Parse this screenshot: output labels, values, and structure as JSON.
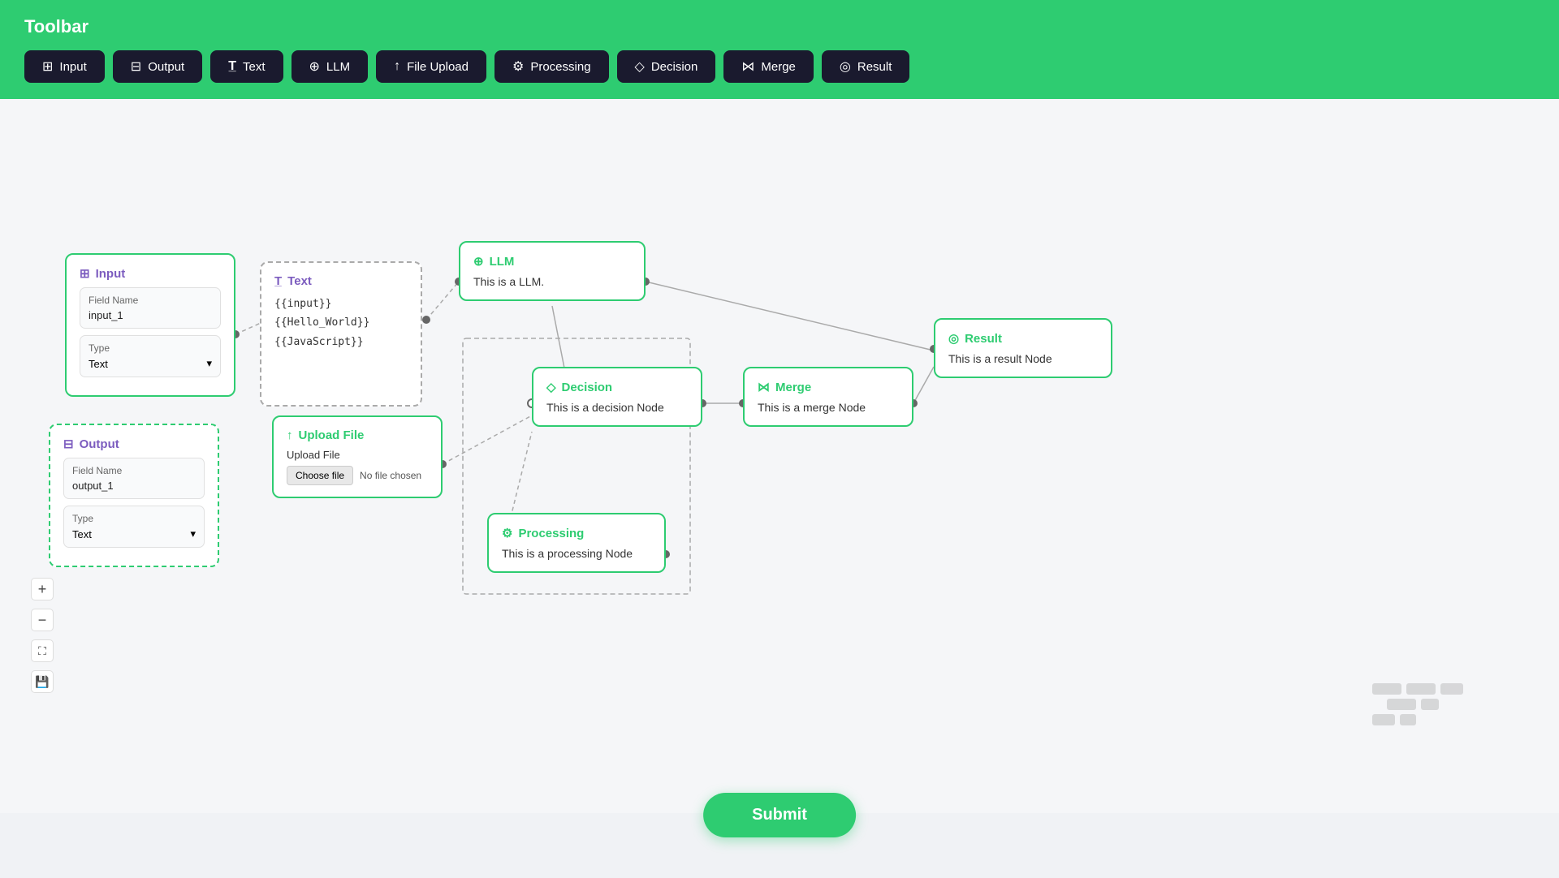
{
  "toolbar": {
    "title": "Toolbar",
    "buttons": [
      {
        "id": "input",
        "label": "Input",
        "icon": "⊞"
      },
      {
        "id": "output",
        "label": "Output",
        "icon": "⊟"
      },
      {
        "id": "text",
        "label": "Text",
        "icon": "T"
      },
      {
        "id": "llm",
        "label": "LLM",
        "icon": "⊕"
      },
      {
        "id": "file-upload",
        "label": "File Upload",
        "icon": "↑"
      },
      {
        "id": "processing",
        "label": "Processing",
        "icon": "⚙"
      },
      {
        "id": "decision",
        "label": "Decision",
        "icon": "◇"
      },
      {
        "id": "merge",
        "label": "Merge",
        "icon": "⋈"
      },
      {
        "id": "result",
        "label": "Result",
        "icon": "◎"
      }
    ]
  },
  "nodes": {
    "input": {
      "title": "Input",
      "field_name_label": "Field Name",
      "field_name_value": "input_1",
      "type_label": "Type",
      "type_value": "Text"
    },
    "output": {
      "title": "Output",
      "field_name_label": "Field Name",
      "field_name_value": "output_1",
      "type_label": "Type",
      "type_value": "Text"
    },
    "text": {
      "title": "Text",
      "content": "{{input}}\n{{Hello_World}}\n{{JavaScript}}"
    },
    "llm": {
      "title": "LLM",
      "body": "This is a LLM."
    },
    "decision": {
      "title": "Decision",
      "body": "This is a decision Node"
    },
    "merge": {
      "title": "Merge",
      "body": "This is a merge Node"
    },
    "result": {
      "title": "Result",
      "body": "This is a result Node"
    },
    "upload": {
      "title": "Upload File",
      "label": "Upload File",
      "choose_btn": "Choose file",
      "no_file": "No file chosen"
    },
    "processing": {
      "title": "Processing",
      "body": "This is a processing Node"
    }
  },
  "controls": {
    "zoom_in": "+",
    "zoom_out": "−",
    "fit": "⛶",
    "save": "💾"
  },
  "submit_label": "Submit"
}
